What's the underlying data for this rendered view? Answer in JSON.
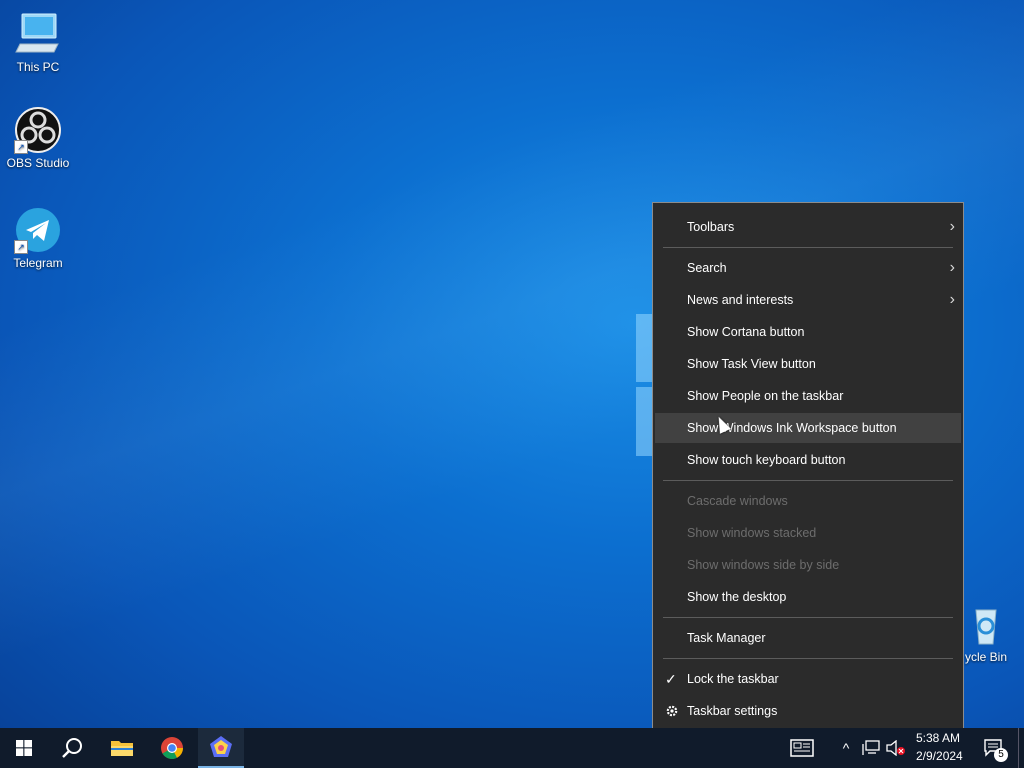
{
  "desktop": {
    "icons": [
      {
        "label": "This PC",
        "icon": "computer-icon"
      },
      {
        "label": "OBS Studio",
        "icon": "obs-icon"
      },
      {
        "label": "Telegram",
        "icon": "telegram-icon"
      },
      {
        "label": "ycle Bin",
        "icon": "recycle-bin-icon"
      }
    ]
  },
  "context_menu": {
    "items": [
      {
        "label": "Toolbars",
        "submenu": true
      },
      {
        "label": "Search",
        "submenu": true
      },
      {
        "label": "News and interests",
        "submenu": true
      },
      {
        "label": "Show Cortana button"
      },
      {
        "label": "Show Task View button"
      },
      {
        "label": "Show People on the taskbar"
      },
      {
        "label": "Show Windows Ink Workspace button",
        "highlighted": true
      },
      {
        "label": "Show touch keyboard button"
      },
      {
        "label": "Cascade windows",
        "disabled": true
      },
      {
        "label": "Show windows stacked",
        "disabled": true
      },
      {
        "label": "Show windows side by side",
        "disabled": true
      },
      {
        "label": "Show the desktop"
      },
      {
        "label": "Task Manager"
      },
      {
        "label": "Lock the taskbar",
        "checked": true
      },
      {
        "label": "Taskbar settings",
        "icon": "gear-icon"
      }
    ],
    "submenu_glyph": "›",
    "check_glyph": "✓"
  },
  "taskbar": {
    "apps": [
      "start-icon",
      "search-icon",
      "file-explorer-icon",
      "chrome-icon",
      "app-icon"
    ],
    "tray": {
      "time": "5:38 AM",
      "date": "2/9/2024",
      "notification_count": "5"
    }
  },
  "colors": {
    "menu_bg": "#2b2b2b",
    "menu_highlight": "#414141",
    "taskbar_bg": "#101b2b",
    "disabled_text": "#6d6d6d"
  }
}
